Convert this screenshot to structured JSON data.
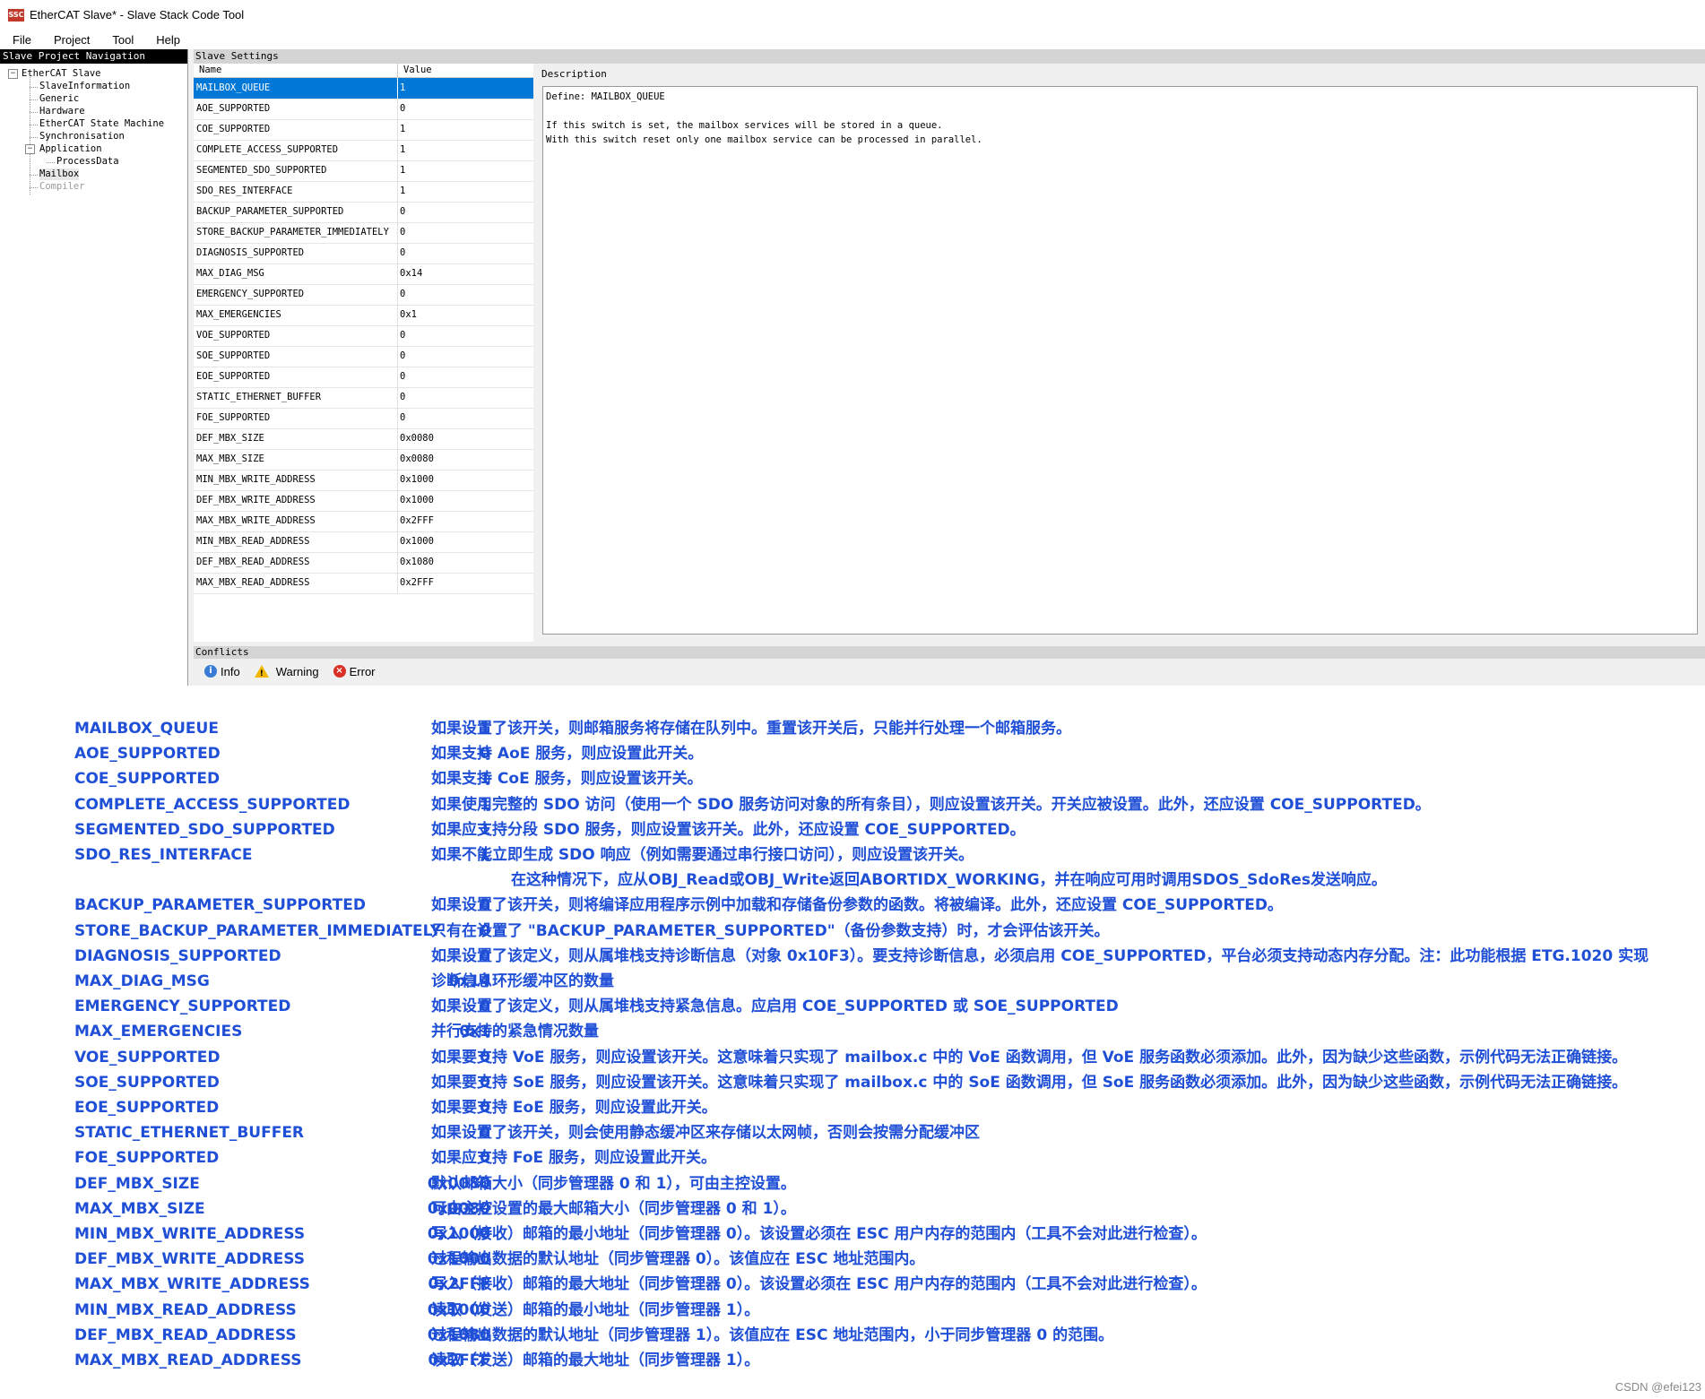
{
  "window": {
    "title": "EtherCAT Slave* - Slave Stack Code Tool",
    "icon_text": "SSC"
  },
  "menu": {
    "file": "File",
    "project": "Project",
    "tool": "Tool",
    "help": "Help"
  },
  "nav": {
    "header": "Slave Project Navigation",
    "root": "EtherCAT Slave",
    "items": {
      "slave_information": "SlaveInformation",
      "generic": "Generic",
      "hardware": "Hardware",
      "state_machine": "EtherCAT State Machine",
      "synchronisation": "Synchronisation",
      "application": "Application",
      "process_data": "ProcessData",
      "mailbox": "Mailbox",
      "compiler": "Compiler"
    }
  },
  "settings": {
    "header": "Slave Settings",
    "col_name": "Name",
    "col_value": "Value",
    "rows": [
      {
        "name": "MAILBOX_QUEUE",
        "value": "1"
      },
      {
        "name": "AOE_SUPPORTED",
        "value": "0"
      },
      {
        "name": "COE_SUPPORTED",
        "value": "1"
      },
      {
        "name": "COMPLETE_ACCESS_SUPPORTED",
        "value": "1"
      },
      {
        "name": "SEGMENTED_SDO_SUPPORTED",
        "value": "1"
      },
      {
        "name": "SDO_RES_INTERFACE",
        "value": "1"
      },
      {
        "name": "BACKUP_PARAMETER_SUPPORTED",
        "value": "0"
      },
      {
        "name": "STORE_BACKUP_PARAMETER_IMMEDIATELY",
        "value": "0"
      },
      {
        "name": "DIAGNOSIS_SUPPORTED",
        "value": "0"
      },
      {
        "name": "MAX_DIAG_MSG",
        "value": "0x14"
      },
      {
        "name": "EMERGENCY_SUPPORTED",
        "value": "0"
      },
      {
        "name": "MAX_EMERGENCIES",
        "value": "0x1"
      },
      {
        "name": "VOE_SUPPORTED",
        "value": "0"
      },
      {
        "name": "SOE_SUPPORTED",
        "value": "0"
      },
      {
        "name": "EOE_SUPPORTED",
        "value": "0"
      },
      {
        "name": "STATIC_ETHERNET_BUFFER",
        "value": "0"
      },
      {
        "name": "FOE_SUPPORTED",
        "value": "0"
      },
      {
        "name": "DEF_MBX_SIZE",
        "value": "0x0080"
      },
      {
        "name": "MAX_MBX_SIZE",
        "value": "0x0080"
      },
      {
        "name": "MIN_MBX_WRITE_ADDRESS",
        "value": "0x1000"
      },
      {
        "name": "DEF_MBX_WRITE_ADDRESS",
        "value": "0x1000"
      },
      {
        "name": "MAX_MBX_WRITE_ADDRESS",
        "value": "0x2FFF"
      },
      {
        "name": "MIN_MBX_READ_ADDRESS",
        "value": "0x1000"
      },
      {
        "name": "DEF_MBX_READ_ADDRESS",
        "value": "0x1080"
      },
      {
        "name": "MAX_MBX_READ_ADDRESS",
        "value": "0x2FFF"
      }
    ]
  },
  "description": {
    "label": "Description",
    "text": "Define: MAILBOX_QUEUE\n\nIf this switch is set, the mailbox services will be stored in a queue.\nWith this switch reset only one mailbox service can be processed in parallel."
  },
  "conflicts": {
    "header": "Conflicts",
    "info": "Info",
    "warning": "Warning",
    "error": "Error"
  },
  "notes": [
    {
      "name": "MAILBOX_QUEUE",
      "value": "1",
      "desc": "如果设置了该开关，则邮箱服务将存储在队列中。重置该开关后，只能并行处理一个邮箱服务。"
    },
    {
      "name": "AOE_SUPPORTED",
      "value": "0",
      "desc": "如果支持 AoE 服务，则应设置此开关。"
    },
    {
      "name": "COE_SUPPORTED",
      "value": "1",
      "desc": "如果支持 CoE 服务，则应设置该开关。"
    },
    {
      "name": "COMPLETE_ACCESS_SUPPORTED",
      "value": "1",
      "desc": "如果使用完整的 SDO 访问（使用一个 SDO 服务访问对象的所有条目），则应设置该开关。开关应被设置。此外，还应设置 COE_SUPPORTED。"
    },
    {
      "name": "SEGMENTED_SDO_SUPPORTED",
      "value": "1",
      "desc": " 如果应支持分段 SDO 服务，则应设置该开关。此外，还应设置 COE_SUPPORTED。"
    },
    {
      "name": "SDO_RES_INTERFACE",
      "value": "1",
      "desc": "如果不能立即生成 SDO 响应（例如需要通过串行接口访问），则应设置该开关。"
    },
    {
      "name": "BACKUP_PARAMETER_SUPPORTED",
      "value": "0",
      "desc": "如果设置了该开关，则将编译应用程序示例中加载和存储备份参数的函数。将被编译。此外，还应设置 COE_SUPPORTED。"
    },
    {
      "name": "STORE_BACKUP_PARAMETER_IMMEDIATELY",
      "value": "0",
      "desc": "只有在设置了 \"BACKUP_PARAMETER_SUPPORTED\"（备份参数支持）时，才会评估该开关。"
    },
    {
      "name": "DIAGNOSIS_SUPPORTED",
      "value": "0",
      "desc": "如果设置了该定义，则从属堆栈支持诊断信息（对象 0x10F3）。要支持诊断信息，必须启用 COE_SUPPORTED，平台必须支持动态内存分配。注：此功能根据 ETG.1020 实现"
    },
    {
      "name": "MAX_DIAG_MSG",
      "value": "0x14",
      "desc": "诊断信息环形缓冲区的数量"
    },
    {
      "name": "EMERGENCY_SUPPORTED",
      "value": "0",
      "desc": "如果设置了该定义，则从属堆栈支持紧急信息。应启用 COE_SUPPORTED 或 SOE_SUPPORTED"
    },
    {
      "name": "MAX_EMERGENCIES",
      "value": "0x1",
      "desc": "并行支持的紧急情况数量"
    },
    {
      "name": "VOE_SUPPORTED",
      "value": "0",
      "desc": "如果要支持 VoE 服务，则应设置该开关。这意味着只实现了 mailbox.c 中的 VoE 函数调用，但 VoE 服务函数必须添加。此外，因为缺少这些函数，示例代码无法正确链接。"
    },
    {
      "name": "SOE_SUPPORTED",
      "value": "0",
      "desc": "如果要支持 SoE 服务，则应设置该开关。这意味着只实现了 mailbox.c 中的 SoE 函数调用，但 SoE 服务函数必须添加。此外，因为缺少这些函数，示例代码无法正确链接。"
    },
    {
      "name": "EOE_SUPPORTED",
      "value": "0",
      "desc": "如果要支持 EoE 服务，则应设置此开关。"
    },
    {
      "name": "STATIC_ETHERNET_BUFFER",
      "value": "0",
      "desc": "如果设置了该开关，则会使用静态缓冲区来存储以太网帧，否则会按需分配缓冲区"
    },
    {
      "name": "FOE_SUPPORTED",
      "value": "0",
      "desc": "如果应支持 FoE 服务，则应设置此开关。"
    },
    {
      "name": "DEF_MBX_SIZE",
      "value": "0x0080",
      "desc": "默认邮箱大小（同步管理器 0 和 1），可由主控设置。"
    },
    {
      "name": "MAX_MBX_SIZE",
      "value": "0x0080",
      "desc": "可由主控设置的最大邮箱大小（同步管理器 0 和 1）。"
    },
    {
      "name": "MIN_MBX_WRITE_ADDRESS",
      "value": "0x1000",
      "desc": "写入（接收）邮箱的最小地址（同步管理器 0）。该设置必须在 ESC 用户内存的范围内（工具不会对此进行检查）。"
    },
    {
      "name": "DEF_MBX_WRITE_ADDRESS",
      "value": "0x1000",
      "desc": "过程输出数据的默认地址（同步管理器 0）。该值应在 ESC 地址范围内。"
    },
    {
      "name": "MAX_MBX_WRITE_ADDRESS",
      "value": "0x2FFF",
      "desc": "写入（接收）邮箱的最大地址（同步管理器 0）。该设置必须在 ESC 用户内存的范围内（工具不会对此进行检查）。"
    },
    {
      "name": "MIN_MBX_READ_ADDRESS",
      "value": "0x1000",
      "desc": "读取（发送）邮箱的最小地址（同步管理器 1）。"
    },
    {
      "name": "DEF_MBX_READ_ADDRESS",
      "value": "0x1080",
      "desc": "过程输出数据的默认地址（同步管理器 1）。该值应在 ESC 地址范围内，小于同步管理器 0 的范围。"
    },
    {
      "name": "MAX_MBX_READ_ADDRESS",
      "value": "0x2FFF",
      "desc": "读取（发送）邮箱的最大地址（同步管理器 1）。"
    }
  ],
  "sdo_res_note_continuation": "在这种情况下，应从OBJ_Read或OBJ_Write返回ABORTIDX_WORKING，并在响应可用时调用SDOS_SdoRes发送响应。",
  "watermark": "CSDN @efei123"
}
